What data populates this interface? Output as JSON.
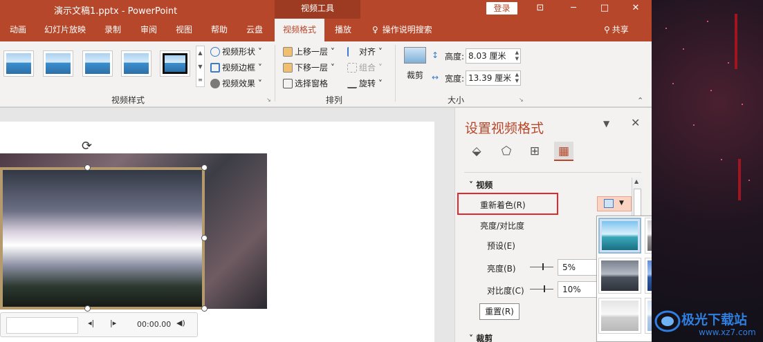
{
  "title_bar": {
    "doc_title": "演示文稿1.pptx  -  PowerPoint",
    "context_tab": "视频工具",
    "login": "登录",
    "controls": {
      "ribbon_display": "⊡",
      "minimize": "─",
      "maximize": "□",
      "close": "✕"
    }
  },
  "tabs": {
    "animation": "动画",
    "slideshow": "幻灯片放映",
    "record": "录制",
    "review": "审阅",
    "view": "视图",
    "help": "帮助",
    "cloud": "云盘",
    "video_format": "视频格式",
    "playback": "播放",
    "tell_me": "操作说明搜索",
    "share": "共享"
  },
  "ribbon": {
    "video_styles": {
      "label": "视频样式",
      "shape": "视频形状",
      "border": "视频边框",
      "effects": "视频效果"
    },
    "arrange": {
      "label": "排列",
      "bring_forward": "上移一层",
      "send_backward": "下移一层",
      "selection_pane": "选择窗格",
      "align": "对齐",
      "group": "组合",
      "rotate": "旋转"
    },
    "size": {
      "label": "大小",
      "crop": "裁剪",
      "height_label": "高度:",
      "height_value": "8.03 厘米",
      "width_label": "宽度:",
      "width_value": "13.39 厘米"
    }
  },
  "media_bar": {
    "time": "00:00.00"
  },
  "format_pane": {
    "title": "设置视频格式",
    "section_video": "视频",
    "recolor": "重新着色(R)",
    "brightness_contrast": "亮度/对比度",
    "presets": "预设(E)",
    "brightness_label": "亮度(B)",
    "brightness_value": "5%",
    "contrast_label": "对比度(C)",
    "contrast_value": "10%",
    "reset": "重置(R)",
    "section_crop": "裁剪"
  },
  "watermark": {
    "name": "极光下载站",
    "url": "www.xz7.com"
  },
  "colors": {
    "accent": "#b7472a",
    "highlight_box": "#e0282e",
    "watermark_blue": "#2f7fe0"
  }
}
